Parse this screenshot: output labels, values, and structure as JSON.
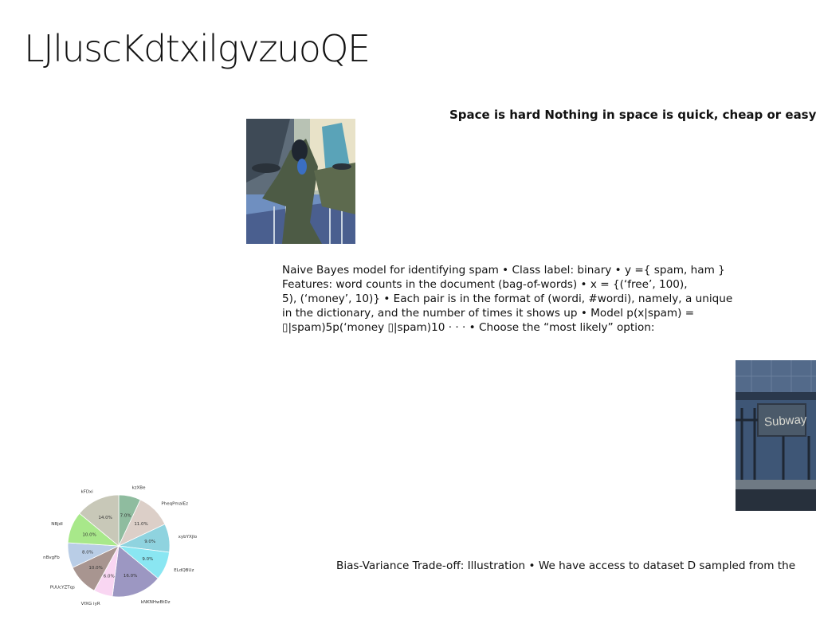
{
  "slide": {
    "title": "LJluscKdtxilgvzuoQE",
    "quote": "Space is hard Nothing in space is quick, cheap or easy",
    "paragraph_lines": [
      "Naive Bayes model for identifying spam • Class label: binary • y ={ spam, ham }",
      "Features: word counts in the document (bag-of-words) • x = {(‘free’, 100),",
      "5), (‘money’, 10)} • Each pair is in the format of (wordi, #wordi), namely, a unique",
      "in the dictionary, and the number of times it shows up • Model p(x|spam) =",
      "▯|spam)5p(‘money ▯|spam)10 · · · • Choose the “most likely” option:"
    ],
    "bias_text": "Bias-Variance Trade-off: Illustration • We have access to dataset D sampled from the",
    "photo_sign_text": "Subway"
  },
  "chart_data": {
    "type": "pie",
    "categories": [
      "kzXBe",
      "PheqPmalEz",
      "xybYXjlo",
      "ELdQBUz",
      "kNKNHwBtDz",
      "VfXG iyR",
      "PUUcYZTqs",
      "nBvgFb",
      "NBjdI",
      "kFDxi"
    ],
    "values": [
      7.0,
      11.0,
      9.0,
      9.0,
      16.0,
      6.0,
      10.0,
      8.0,
      10.0,
      14.0
    ],
    "value_labels": [
      "7.0%",
      "11.0%",
      "9.0%",
      "9.0%",
      "16.0%",
      "6.0%",
      "10.0%",
      "8.0%",
      "10.0%",
      "14.0%"
    ],
    "colors": [
      "#8fbc9f",
      "#dccfc8",
      "#8fd3df",
      "#8ae6f2",
      "#9c97c2",
      "#f9d6f2",
      "#a89590",
      "#b9cde6",
      "#a8e88a",
      "#c8c8b8"
    ],
    "start_angle_deg": 90,
    "direction": "clockwise"
  }
}
